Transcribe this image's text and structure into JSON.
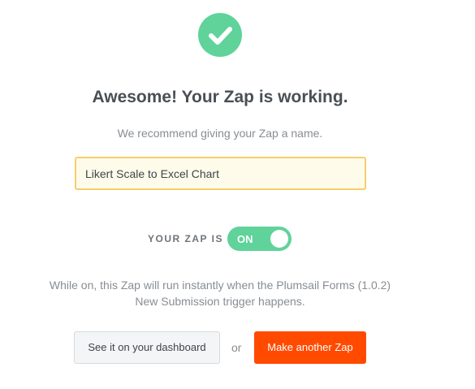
{
  "success": {
    "icon": "check-icon",
    "color": "#5fd39a"
  },
  "headline": "Awesome! Your Zap is working.",
  "name_prompt": "We recommend giving your Zap a name.",
  "name_input": {
    "value": "Likert Scale to Excel Chart",
    "border_color": "#f5cf6b",
    "background": "#fffbeb"
  },
  "status": {
    "label": "YOUR ZAP IS",
    "toggle_text": "ON",
    "toggle_state": true,
    "toggle_color": "#5fd39a"
  },
  "description": "While on, this Zap will run instantly when the Plumsail Forms (1.0.2) New Submission trigger happens.",
  "actions": {
    "dashboard_label": "See it on your dashboard",
    "separator": "or",
    "another_label": "Make another Zap",
    "another_color": "#ff4a00"
  }
}
